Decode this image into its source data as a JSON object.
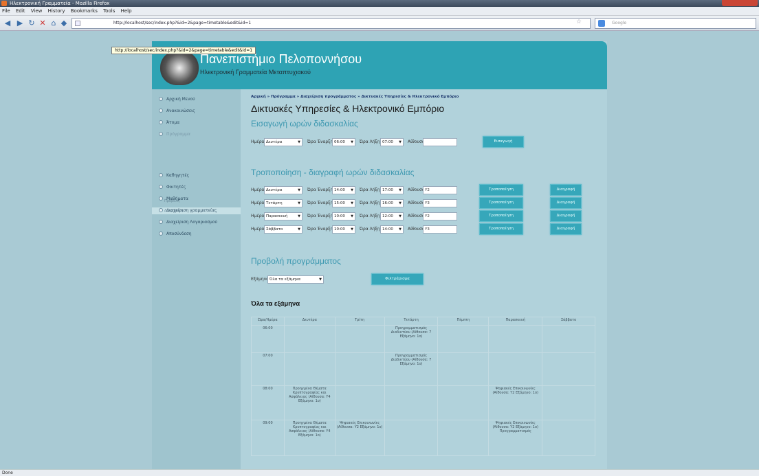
{
  "window": {
    "title": "Ηλεκτρονική Γραμματεία - Mozilla Firefox"
  },
  "menu": [
    "File",
    "Edit",
    "View",
    "History",
    "Bookmarks",
    "Tools",
    "Help"
  ],
  "nav": {
    "url": "http://localhost/sec/index.php?&id=2&page=timetable&edit&id=1",
    "search_placeholder": "Google",
    "tooltip": "http://localhost/sec/index.php?&id=2&page=timetable&edit&id=1"
  },
  "site": {
    "title": "Πανεπιστήμιο Πελοποννήσου",
    "subtitle": "Ηλεκτρονική Γραμματεία Μεταπτυχιακού"
  },
  "sidebar": {
    "items": [
      {
        "label": "Αρχική Μενού"
      },
      {
        "label": "Ανακοινώσεις"
      },
      {
        "label": "Άτομα"
      },
      {
        "label": "Πρόγραμμα"
      },
      {
        "label": "Καθηγητές"
      },
      {
        "label": "Φοιτητές"
      },
      {
        "label": "Μαθήματα"
      },
      {
        "label": "Διαχείριση γραμματείας"
      },
      {
        "label": "Διαχείριση Λογαριασμού"
      },
      {
        "label": "Αποσύνδεση"
      }
    ],
    "subitems": [
      "Προβολή",
      "Διαχείριση"
    ]
  },
  "content": {
    "breadcrumb": "Αρχική » Πρόγραμμα » Διαχείριση προγράμματος » Δικτυακές Υπηρεσίες & Ηλεκτρονικό Εμπόριο",
    "title": "Δικτυακές Υπηρεσίες & Ηλεκτρονικό Εμπόριο",
    "insert_heading": "Εισαγωγή ωρών διδασκαλίας",
    "labels": {
      "day": "Ημέρα",
      "start": "Ώρα Έναρξης",
      "end": "Ώρα Λήξης",
      "room": "Αίθουσα"
    },
    "insert": {
      "day": "Δευτέρα",
      "start": "06:00",
      "end": "07:00",
      "room": "",
      "button": "Εισαγωγή"
    },
    "edit_heading": "Τροποποίηση - διαγραφή ωρών διδασκαλίας",
    "rows": [
      {
        "day": "Δευτέρα",
        "start": "14:00",
        "end": "17:00",
        "room": "Υ2"
      },
      {
        "day": "Τετάρτη",
        "start": "15:00",
        "end": "16:00",
        "room": "Υ3"
      },
      {
        "day": "Παρασκευή",
        "start": "10:00",
        "end": "12:00",
        "room": "Υ2"
      },
      {
        "day": "Σάββατο",
        "start": "10:00",
        "end": "14:00",
        "room": "Υ3"
      }
    ],
    "edit_button": "Τροποποίηση",
    "delete_button": "Διαγραφή",
    "view_heading": "Προβολή προγράμματος",
    "semester_label": "Εξάμηνο",
    "semester_value": "Όλα τα εξάμηνα",
    "filter_button": "Φιλτράρισμα",
    "table_heading": "Όλα τα εξάμηνα",
    "table": {
      "headers": [
        "Ώρα/Ημέρα",
        "Δευτέρα",
        "Τρίτη",
        "Τετάρτη",
        "Πέμπτη",
        "Παρασκευή",
        "Σάββατο"
      ],
      "rows": [
        [
          "06:00",
          "",
          "",
          "Προγραμματισμός Διαδικτύου (Αίθουσα: 7 Εξάμηνο: 1ο)",
          "",
          "",
          ""
        ],
        [
          "07:00",
          "",
          "",
          "Προγραμματισμός Διαδικτύου (Αίθουσα: 7 Εξάμηνο: 1ο)",
          "",
          "",
          ""
        ],
        [
          "08:00",
          "Προηγμένα Θέματα Κρυπτογραφίας και Ασφάλειας (Αίθουσα: Υ4 Εξάμηνο: 1ο)",
          "",
          "",
          "",
          "Ψηφιακές Επικοινωνίες (Αίθουσα: Υ2 Εξάμηνο: 1ο)",
          ""
        ],
        [
          "09:00",
          "Προηγμένα Θέματα Κρυπτογραφίας και Ασφάλειας (Αίθουσα: Υ4 Εξάμηνο: 1ο)",
          "Ψηφιακές Επικοινωνίες (Αίθουσα: Υ2 Εξάμηνο: 1ο)",
          "",
          "",
          "Ψηφιακές Επικοινωνίες (Αίθουσα: Υ2 Εξάμηνο: 1ο) Προγραμματισμός",
          ""
        ]
      ]
    }
  },
  "status": "Done",
  "colors": {
    "banner": "#2ea3b4",
    "heading": "#3d98b0",
    "button": "#36a7ba",
    "page_bg": "#a9cad4"
  }
}
